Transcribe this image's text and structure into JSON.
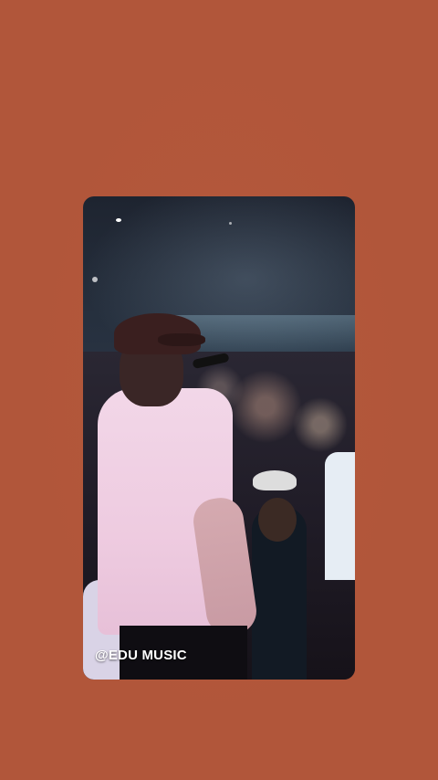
{
  "story": {
    "caption": "@EDU MUSIC"
  },
  "colors": {
    "background": "#b1563a",
    "caption_text": "#ffffff"
  }
}
